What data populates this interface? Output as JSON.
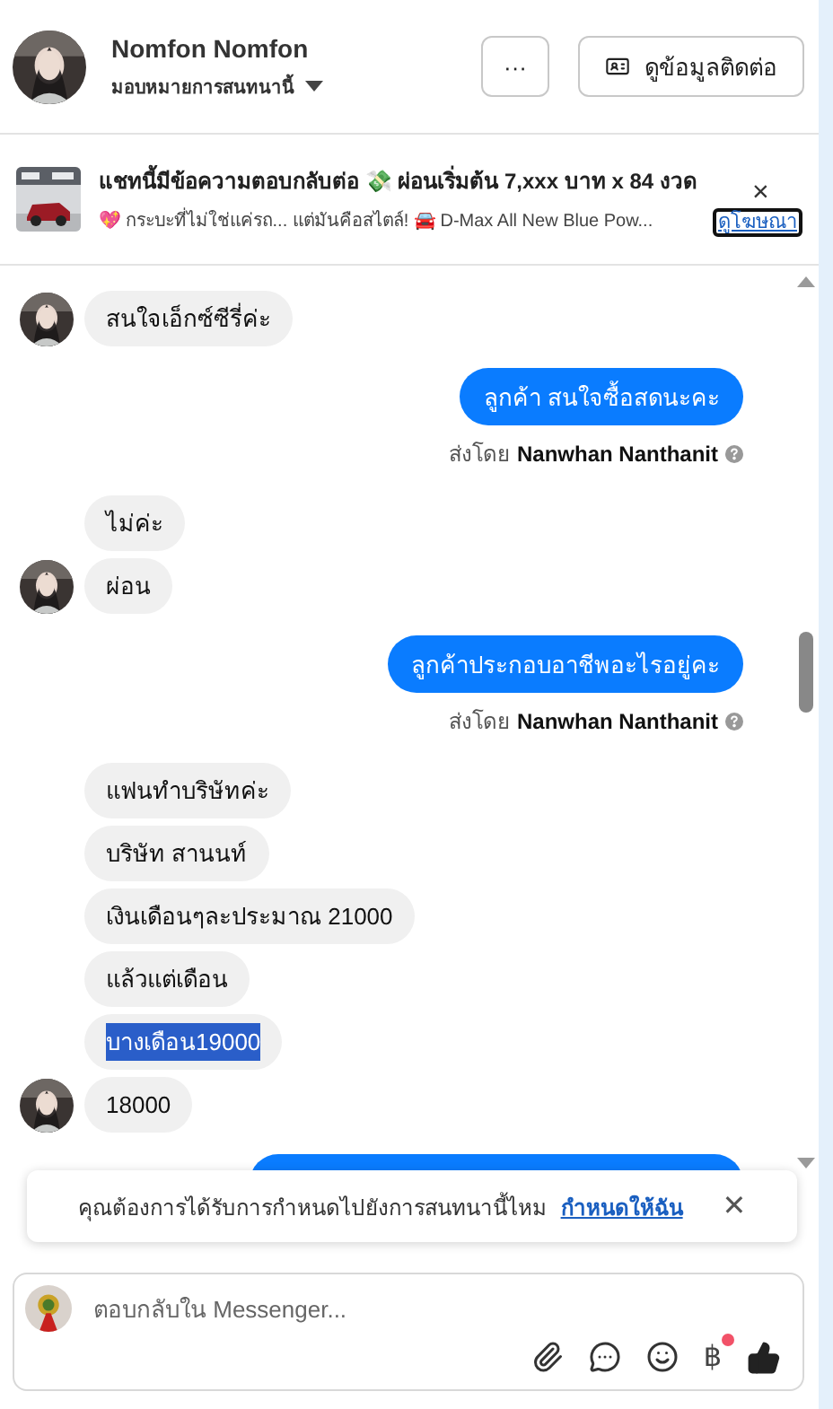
{
  "header": {
    "name": "Nomfon Nomfon",
    "assign_label": "มอบหมายการสนทนานี้",
    "more_button": "···",
    "contact_button": "ดูข้อมูลติดต่อ"
  },
  "ad": {
    "title": "แชทนี้มีข้อความตอบกลับต่อ 💸 ผ่อนเริ่มต้น 7,xxx บาท x 84 งวด",
    "subtitle": "💖 กระบะที่ไม่ใช่แค่รถ... แต่มันคือสไตล์! 🚘 D-Max All New Blue Pow...",
    "link": "ดูโฆษณา",
    "close": "×"
  },
  "messages": [
    {
      "kind": "incoming",
      "text": "สนใจเอ็กซ์ซีรี่ค่ะ",
      "avatar": true,
      "selected": false
    },
    {
      "kind": "outgoing",
      "text": "ลูกค้า สนใจซื้อสดนะคะ",
      "sent_by": "ส่งโดย",
      "sender": "Nanwhan Nanthanit",
      "selected": false
    },
    {
      "kind": "incoming",
      "text": "ไม่ค่ะ",
      "avatar": false,
      "selected": false
    },
    {
      "kind": "incoming",
      "text": "ผ่อน",
      "avatar": true,
      "selected": false
    },
    {
      "kind": "outgoing",
      "text": "ลูกค้าประกอบอาชีพอะไรอยู่คะ",
      "sent_by": "ส่งโดย",
      "sender": "Nanwhan Nanthanit",
      "selected": false
    },
    {
      "kind": "incoming",
      "text": "แฟนทำบริษัทค่ะ",
      "avatar": false,
      "selected": false
    },
    {
      "kind": "incoming",
      "text": "บริษัท สานนท์",
      "avatar": false,
      "selected": false
    },
    {
      "kind": "incoming",
      "text": "เงินเดือนๆละประมาณ 21000",
      "avatar": false,
      "selected": false
    },
    {
      "kind": "incoming",
      "text": "แล้วแต่เดือน",
      "avatar": false,
      "selected": false
    },
    {
      "kind": "incoming",
      "text": "บางเดือน19000",
      "avatar": false,
      "selected": true
    },
    {
      "kind": "incoming",
      "text": "18000",
      "avatar": true,
      "selected": false
    },
    {
      "kind": "outgoing_hidden"
    }
  ],
  "notice": {
    "text": "คุณต้องการได้รับการกำหนดไปยังการสนทนานี้ไหม",
    "link": "กำหนดให้ฉัน",
    "close": "✕"
  },
  "composer": {
    "placeholder": "ตอบกลับใน Messenger...",
    "payment_symbol": "฿",
    "payment_alert": true
  }
}
